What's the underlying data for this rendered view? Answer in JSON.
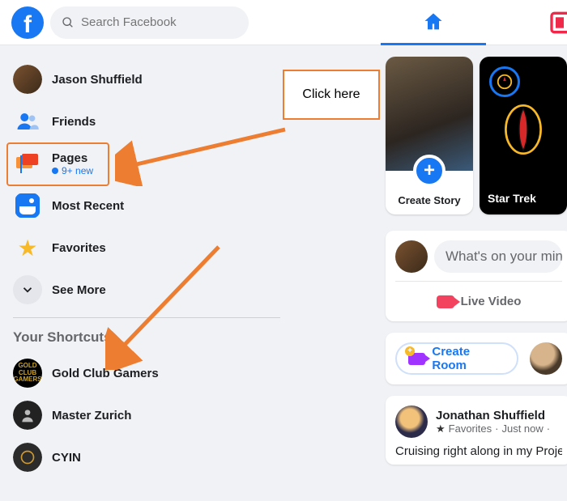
{
  "search": {
    "placeholder": "Search Facebook"
  },
  "callout": "Click here",
  "sidebar": {
    "profile": "Jason Shuffield",
    "friends": "Friends",
    "pages": {
      "label": "Pages",
      "sub": "9+ new"
    },
    "mostrecent": "Most Recent",
    "favorites": "Favorites",
    "seemore": "See More",
    "shortcuts_title": "Your Shortcuts",
    "shortcuts": {
      "gold": "Gold Club Gamers",
      "zurich": "Master Zurich",
      "cyin": "CYIN"
    }
  },
  "stories": {
    "create": "Create Story",
    "startrek": "Star Trek"
  },
  "composer": {
    "placeholder": "What's on your mind,",
    "live": "Live Video"
  },
  "rooms": {
    "create": "Create Room"
  },
  "post": {
    "author": "Jonathan Shuffield",
    "meta_fav": "Favorites",
    "meta_time": "Just now",
    "body": "Cruising right along in my Project"
  }
}
